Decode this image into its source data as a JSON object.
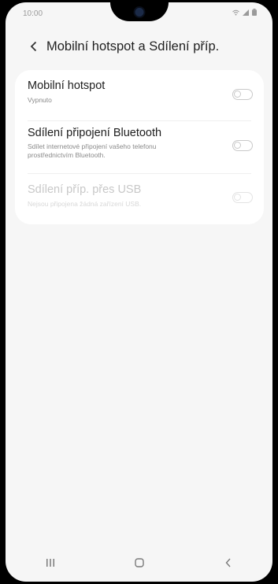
{
  "status_bar": {
    "time": "10:00"
  },
  "header": {
    "title": "Mobilní hotspot a Sdílení příp."
  },
  "settings": [
    {
      "label": "Mobilní hotspot",
      "subtitle": [
        "Vypnuto"
      ],
      "toggle_on": false,
      "enabled": true
    },
    {
      "label": "Sdílení připojení Bluetooth",
      "subtitle": [
        "Sdílet internetové připojení vašeho telefonu",
        "prostřednictvím Bluetooth."
      ],
      "toggle_on": false,
      "enabled": true
    },
    {
      "label": "Sdílení příp. přes USB",
      "subtitle": [
        "Nejsou připojena žádná zařízení USB."
      ],
      "toggle_on": false,
      "enabled": false
    }
  ],
  "nav_icons": [
    "recents-icon",
    "home-icon",
    "back-icon"
  ]
}
